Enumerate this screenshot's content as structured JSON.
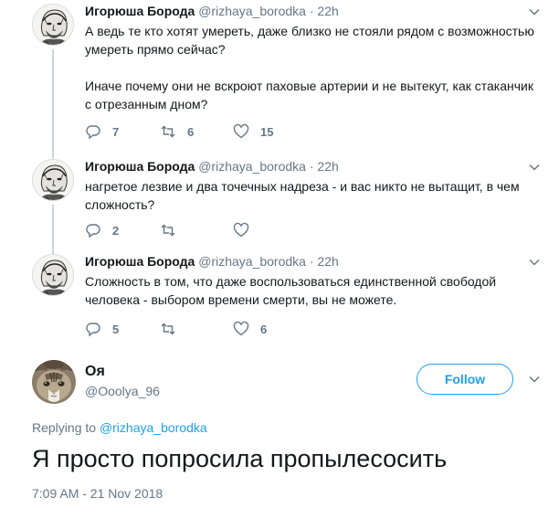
{
  "colors": {
    "accent": "#1da1f2",
    "muted": "#657786",
    "text": "#14171a",
    "thread_line": "#ccd6dd"
  },
  "thread": [
    {
      "name": "Игорюша Борода",
      "handle": "@rizhaya_borodka",
      "separator": "·",
      "time": "22h",
      "paragraphs": [
        "А ведь те кто хотят умереть, даже близко не стояли рядом с возможностью умереть прямо сейчас?",
        "Иначе почему они не вскроют паховые артерии и не вытекут, как стаканчик с отрезанным дном?"
      ],
      "reply_count": "7",
      "retweet_count": "6",
      "like_count": "15"
    },
    {
      "name": "Игорюша Борода",
      "handle": "@rizhaya_borodka",
      "separator": "·",
      "time": "22h",
      "paragraphs": [
        "нагретое лезвие и два точечных надреза - и вас никто не вытащит, в чем сложность?"
      ],
      "reply_count": "2",
      "retweet_count": "",
      "like_count": ""
    },
    {
      "name": "Игорюша Борода",
      "handle": "@rizhaya_borodka",
      "separator": "·",
      "time": "22h",
      "paragraphs": [
        "Сложность в том, что даже воспользоваться единственной свободой человека - выбором времени смерти, вы не можете."
      ],
      "reply_count": "5",
      "retweet_count": "",
      "like_count": "6"
    }
  ],
  "main_tweet": {
    "name": "Оя",
    "handle": "@Ooolya_96",
    "follow_label": "Follow",
    "replying_prefix": "Replying to",
    "replying_to": "@rizhaya_borodka",
    "text": "Я просто попросила пропылесосить",
    "timestamp": "7:09 AM - 21 Nov 2018"
  },
  "icons": {
    "reply": "reply-icon",
    "retweet": "retweet-icon",
    "like": "heart-icon",
    "more": "chevron-down-icon"
  }
}
